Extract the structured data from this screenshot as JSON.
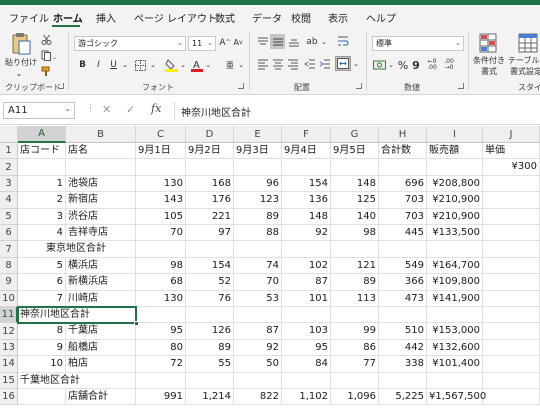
{
  "menu": {
    "tabs": [
      {
        "label": "ファイル",
        "active": false
      },
      {
        "label": "ホーム",
        "active": true
      },
      {
        "label": "挿入",
        "active": false
      },
      {
        "label": "ページ レイアウト",
        "active": false
      },
      {
        "label": "数式",
        "active": false
      },
      {
        "label": "データ",
        "active": false
      },
      {
        "label": "校閲",
        "active": false
      },
      {
        "label": "表示",
        "active": false
      },
      {
        "label": "ヘルプ",
        "active": false
      }
    ]
  },
  "ribbon": {
    "clipboard": {
      "paste_label": "貼り付け",
      "group_label": "クリップボード"
    },
    "font": {
      "font_name": "游ゴシック",
      "font_size": "11",
      "bold": "B",
      "italic": "I",
      "underline": "U",
      "group_label": "フォント"
    },
    "alignment": {
      "group_label": "配置"
    },
    "number": {
      "format": "標準",
      "group_label": "数値"
    },
    "styles": {
      "conditional_label_1": "条件付き",
      "conditional_label_2": "書式",
      "table_label_1": "テーブルと",
      "table_label_2": "書式設定",
      "group_label": "スタイル"
    },
    "accent_color": "#217346"
  },
  "formula_bar": {
    "name_box": "A11",
    "fx": "fx",
    "formula": "神奈川地区合計"
  },
  "sheet": {
    "columns": [
      "A",
      "B",
      "C",
      "D",
      "E",
      "F",
      "G",
      "H",
      "I",
      "J"
    ],
    "selected_column": "A",
    "selected_row": 11,
    "rows": [
      {
        "n": 1,
        "cells": {
          "A": "店コード",
          "B": "店名",
          "C": "9月1日",
          "D": "9月2日",
          "E": "9月3日",
          "F": "9月4日",
          "G": "9月5日",
          "H": "合計数",
          "I": "販売額",
          "J": "単価"
        }
      },
      {
        "n": 2,
        "cells": {
          "J": "¥300"
        }
      },
      {
        "n": 3,
        "cells": {
          "A": "1",
          "B": "池袋店",
          "C": "130",
          "D": "168",
          "E": "96",
          "F": "154",
          "G": "148",
          "H": "696",
          "I": "¥208,800"
        }
      },
      {
        "n": 4,
        "cells": {
          "A": "2",
          "B": "新宿店",
          "C": "143",
          "D": "176",
          "E": "123",
          "F": "136",
          "G": "125",
          "H": "703",
          "I": "¥210,900"
        }
      },
      {
        "n": 5,
        "cells": {
          "A": "3",
          "B": "渋谷店",
          "C": "105",
          "D": "221",
          "E": "89",
          "F": "148",
          "G": "140",
          "H": "703",
          "I": "¥210,900"
        }
      },
      {
        "n": 6,
        "cells": {
          "A": "4",
          "B": "吉祥寺店",
          "C": "70",
          "D": "97",
          "E": "88",
          "F": "92",
          "G": "98",
          "H": "445",
          "I": "¥133,500"
        }
      },
      {
        "n": 7,
        "cells": {
          "A": "東京地区合計"
        }
      },
      {
        "n": 8,
        "cells": {
          "A": "5",
          "B": "横浜店",
          "C": "98",
          "D": "154",
          "E": "74",
          "F": "102",
          "G": "121",
          "H": "549",
          "I": "¥164,700"
        }
      },
      {
        "n": 9,
        "cells": {
          "A": "6",
          "B": "新横浜店",
          "C": "68",
          "D": "52",
          "E": "70",
          "F": "87",
          "G": "89",
          "H": "366",
          "I": "¥109,800"
        }
      },
      {
        "n": 10,
        "cells": {
          "A": "7",
          "B": "川崎店",
          "C": "130",
          "D": "76",
          "E": "53",
          "F": "101",
          "G": "113",
          "H": "473",
          "I": "¥141,900"
        }
      },
      {
        "n": 11,
        "cells": {
          "A": "神奈川地区合計"
        }
      },
      {
        "n": 12,
        "cells": {
          "A": "8",
          "B": "千葉店",
          "C": "95",
          "D": "126",
          "E": "87",
          "F": "103",
          "G": "99",
          "H": "510",
          "I": "¥153,000"
        }
      },
      {
        "n": 13,
        "cells": {
          "A": "9",
          "B": "船橋店",
          "C": "80",
          "D": "89",
          "E": "92",
          "F": "95",
          "G": "86",
          "H": "442",
          "I": "¥132,600"
        }
      },
      {
        "n": 14,
        "cells": {
          "A": "10",
          "B": "柏店",
          "C": "72",
          "D": "55",
          "E": "50",
          "F": "84",
          "G": "77",
          "H": "338",
          "I": "¥101,400"
        }
      },
      {
        "n": 15,
        "cells": {
          "A": "千葉地区合計"
        }
      },
      {
        "n": 16,
        "cells": {
          "B": "店舗合計",
          "C": "991",
          "D": "1,214",
          "E": "822",
          "F": "1,102",
          "G": "1,096",
          "H": "5,225",
          "I": "¥1,567,500"
        }
      }
    ]
  }
}
